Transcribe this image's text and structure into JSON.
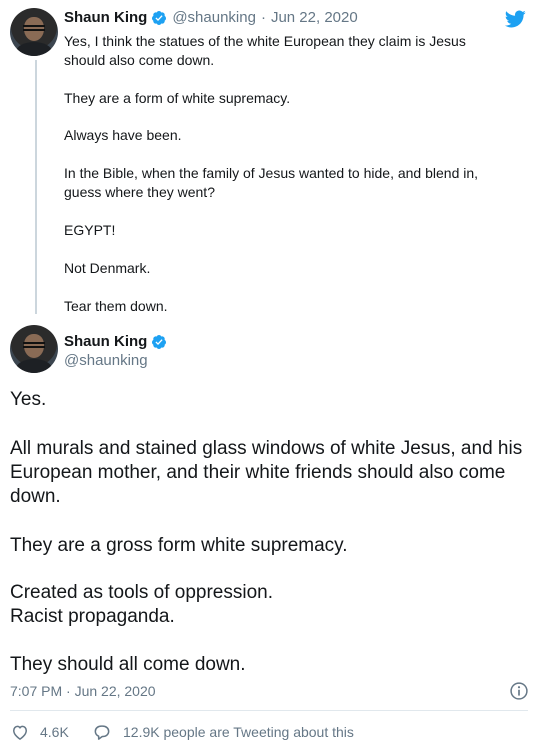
{
  "parent_tweet": {
    "name": "Shaun King",
    "handle": "@shaunking",
    "separator": "·",
    "date": "Jun 22, 2020",
    "lines": [
      "Yes, I think the statues of the white European they claim is Jesus",
      "should also come down.",
      "They are a form of white supremacy.",
      "Always have been.",
      "In the Bible, when the family of Jesus wanted to hide, and blend in,",
      "guess where they went?",
      "EGYPT!",
      "Not Denmark.",
      "Tear them down."
    ]
  },
  "main_tweet": {
    "name": "Shaun King",
    "handle": "@shaunking",
    "lines": [
      "Yes.",
      "All murals and stained glass windows of white Jesus, and his",
      "European mother, and their white friends should also come",
      "down.",
      "They are a gross form white supremacy.",
      "Created as tools of oppression.",
      "Racist propaganda.",
      "They should all come down."
    ],
    "timestamp": "7:07 PM · Jun 22, 2020",
    "likes": "4.6K",
    "retweet_info": "12.9K people are Tweeting about this"
  },
  "colors": {
    "twitter_blue": "#1da1f2",
    "grey": "#657786",
    "text": "#14171a"
  },
  "icons": [
    "twitter-bird-icon",
    "verified-badge-icon",
    "info-icon",
    "heart-icon",
    "comment-icon"
  ]
}
